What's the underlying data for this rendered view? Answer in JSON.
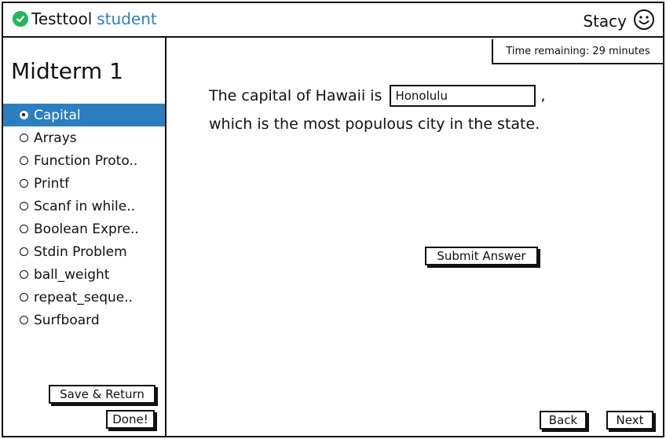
{
  "header": {
    "brand_name": "Testtool",
    "brand_accent": "student",
    "username": "Stacy"
  },
  "sidebar": {
    "title": "Midterm 1",
    "items": [
      {
        "label": "Capital",
        "active": true
      },
      {
        "label": "Arrays",
        "active": false
      },
      {
        "label": "Function Proto..",
        "active": false
      },
      {
        "label": "Printf",
        "active": false
      },
      {
        "label": "Scanf in while..",
        "active": false
      },
      {
        "label": "Boolean Expre..",
        "active": false
      },
      {
        "label": "Stdin Problem",
        "active": false
      },
      {
        "label": "ball_weight",
        "active": false
      },
      {
        "label": "repeat_seque..",
        "active": false
      },
      {
        "label": "Surfboard",
        "active": false
      }
    ],
    "save_return_label": "Save & Return",
    "done_label": "Done!"
  },
  "main": {
    "timer_text": "Time remaining: 29 minutes",
    "question_prefix": "The capital of Hawaii is",
    "answer_value": "Honolulu",
    "question_comma": ",",
    "question_suffix": "which is the most populous city in the state.",
    "submit_label": "Submit Answer",
    "back_label": "Back",
    "next_label": "Next"
  },
  "colors": {
    "accent": "#2b82c4",
    "check": "#27b45b",
    "active_item": "#2b7fc0"
  },
  "icons": [
    "check-circle-icon",
    "smiley-icon",
    "radio-icon"
  ]
}
